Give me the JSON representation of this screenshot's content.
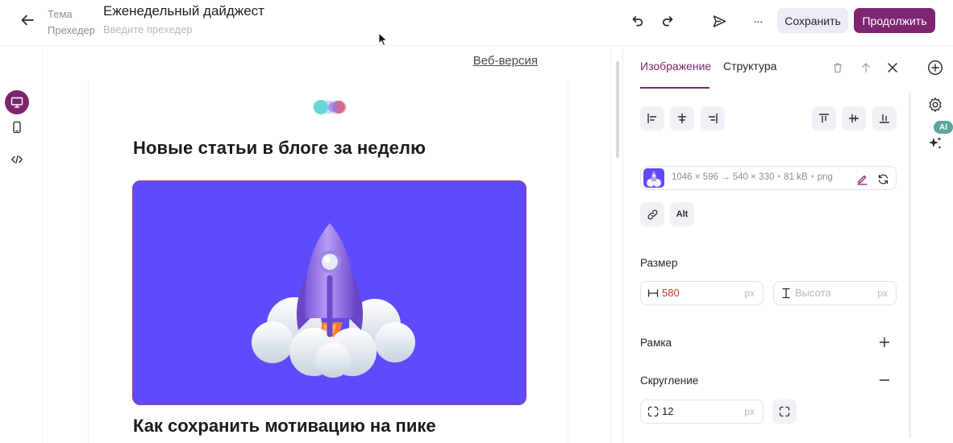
{
  "header": {
    "subject_label": "Тема",
    "preheader_label": "Прехедер",
    "subject_value": "Еженедельный дайджест",
    "preheader_placeholder": "Введите прехедер",
    "save_label": "Сохранить",
    "continue_label": "Продолжить",
    "more_label": "···"
  },
  "canvas": {
    "web_version_link": "Веб-версия",
    "heading_1": "Новые статьи в блоге за неделю",
    "heading_2": "Как сохранить мотивацию на пике"
  },
  "panel": {
    "tabs": [
      {
        "label": "Изображение",
        "active": true
      },
      {
        "label": "Структура",
        "active": false
      }
    ],
    "image_info": {
      "dimensions": "1046 × 596 → 540 × 330",
      "size": "81 kB",
      "format": "png"
    },
    "alt_label": "Alt",
    "size_section": {
      "label": "Размер",
      "width_value": "580",
      "width_unit": "px",
      "height_placeholder": "Высота",
      "height_unit": "px"
    },
    "border_section": {
      "label": "Рамка"
    },
    "radius_section": {
      "label": "Скругление",
      "value": "12",
      "unit": "px"
    }
  },
  "rail": {
    "ai_badge": "AI"
  },
  "colors": {
    "accent": "#7d2570",
    "hero_background": "#5f4bfc",
    "ai_badge": "#5aa59d",
    "error_value": "#c0392b"
  }
}
